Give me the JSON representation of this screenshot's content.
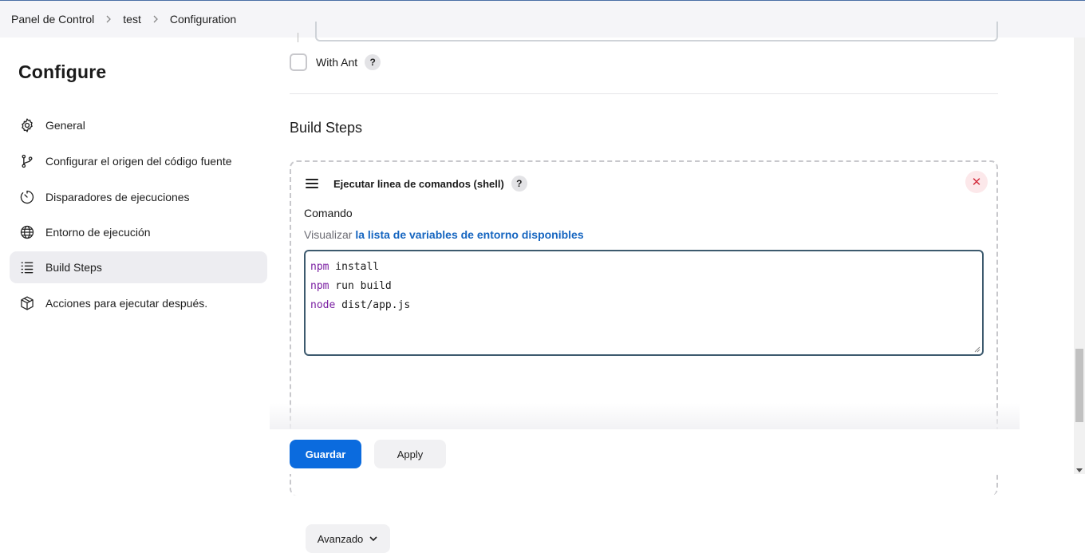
{
  "breadcrumb": {
    "items": [
      "Panel de Control",
      "test",
      "Configuration"
    ]
  },
  "sidebar": {
    "title": "Configure",
    "items": [
      {
        "label": "General",
        "icon": "gear-icon",
        "active": false
      },
      {
        "label": "Configurar el origen del código fuente",
        "icon": "source-branch-icon",
        "active": false
      },
      {
        "label": "Disparadores de ejecuciones",
        "icon": "timer-icon",
        "active": false
      },
      {
        "label": "Entorno de ejecución",
        "icon": "globe-icon",
        "active": false
      },
      {
        "label": "Build Steps",
        "icon": "list-icon",
        "active": true
      },
      {
        "label": "Acciones para ejecutar después.",
        "icon": "package-icon",
        "active": false
      }
    ]
  },
  "main": {
    "with_ant_label": "With Ant",
    "with_ant_checked": false,
    "help_symbol": "?",
    "section_title": "Build Steps",
    "step": {
      "title": "Ejecutar linea de comandos (shell)",
      "close_symbol": "✕",
      "field_label": "Comando",
      "vars_prefix": "Visualizar",
      "vars_link": "la lista de variables de entorno disponibles",
      "command_lines": [
        {
          "kw": "npm",
          "rest": " install"
        },
        {
          "kw": "npm",
          "rest": " run build"
        },
        {
          "kw": "node",
          "rest": " dist/app.js"
        }
      ],
      "advanced_label": "Avanzado"
    }
  },
  "footer": {
    "save_label": "Guardar",
    "apply_label": "Apply"
  },
  "colors": {
    "primary": "#0b6bde",
    "link": "#1565c0",
    "keyword": "#7a1fa2",
    "danger": "#d32f3f"
  }
}
